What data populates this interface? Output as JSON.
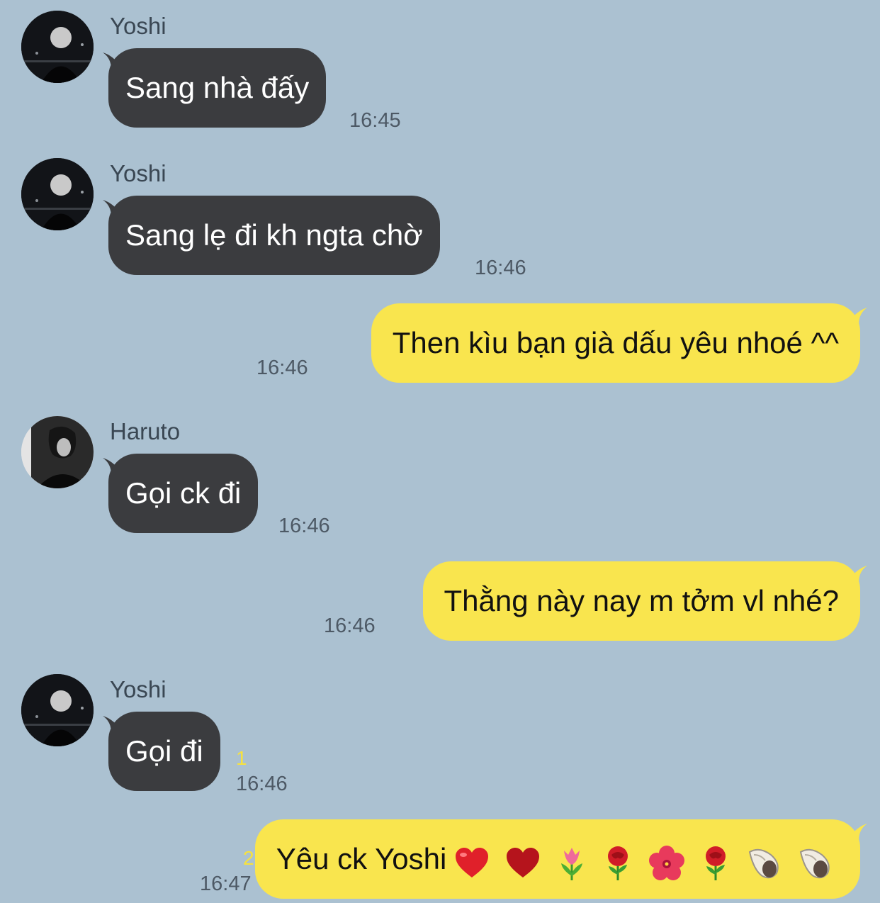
{
  "colors": {
    "background": "#abc1d1",
    "incoming_bubble": "#3b3c3f",
    "outgoing_bubble": "#f9e54e",
    "unread_count": "#f7e23e"
  },
  "messages": [
    {
      "sender": "Yoshi",
      "text": "Sang nhà đấy",
      "time": "16:45"
    },
    {
      "sender": "Yoshi",
      "text": "Sang lẹ đi kh ngta chờ",
      "time": "16:46"
    },
    {
      "text": "Then kìu bạn già dấu yêu nhoé ^^",
      "time": "16:46"
    },
    {
      "sender": "Haruto",
      "text": "Gọi ck đi",
      "time": "16:46"
    },
    {
      "text": "Thằng này nay m tởm vl nhé?",
      "time": "16:46"
    },
    {
      "sender": "Yoshi",
      "text": "Gọi đi",
      "unread": "1",
      "time": "16:46"
    },
    {
      "text": "Yêu ck Yoshi",
      "unread": "2",
      "time": "16:47",
      "emojis": [
        "red-heart",
        "red-heart",
        "tulip",
        "rose",
        "hibiscus",
        "rose",
        "spiral-shell",
        "spiral-shell"
      ]
    }
  ]
}
